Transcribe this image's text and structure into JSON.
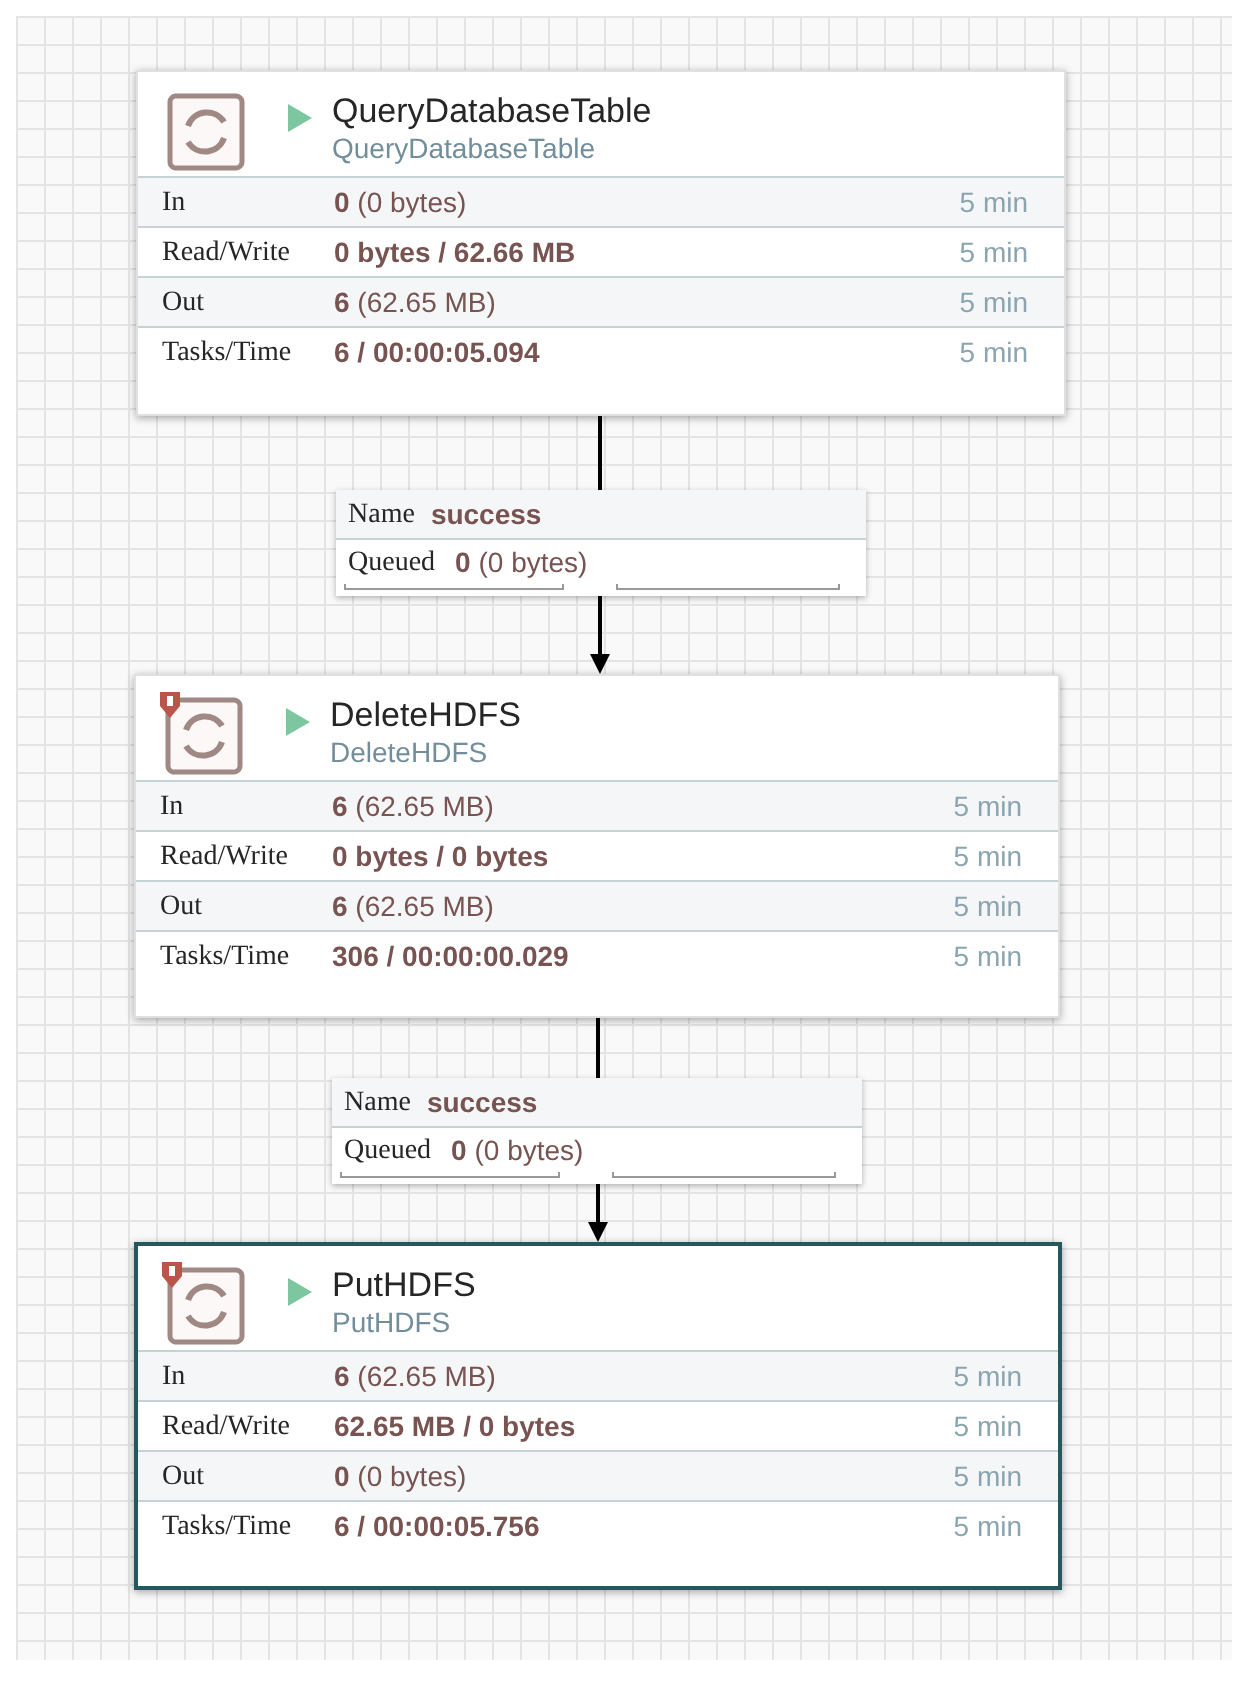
{
  "processors": [
    {
      "name": "QueryDatabaseTable",
      "type": "QueryDatabaseTable",
      "running": true,
      "restricted": false,
      "selected": false,
      "stats": [
        {
          "label": "In",
          "value": "**0** (0 bytes)",
          "time": "5 min"
        },
        {
          "label": "Read/Write",
          "value": "**0 bytes / 62.66 MB**",
          "time": "5 min"
        },
        {
          "label": "Out",
          "value": "**6** (62.65 MB)",
          "time": "5 min"
        },
        {
          "label": "Tasks/Time",
          "value": "**6 / 00:00:05.094**",
          "time": "5 min"
        }
      ]
    },
    {
      "name": "DeleteHDFS",
      "type": "DeleteHDFS",
      "running": true,
      "restricted": true,
      "selected": false,
      "stats": [
        {
          "label": "In",
          "value": "**6** (62.65 MB)",
          "time": "5 min"
        },
        {
          "label": "Read/Write",
          "value": "**0 bytes / 0 bytes**",
          "time": "5 min"
        },
        {
          "label": "Out",
          "value": "**6** (62.65 MB)",
          "time": "5 min"
        },
        {
          "label": "Tasks/Time",
          "value": "**306 / 00:00:00.029**",
          "time": "5 min"
        }
      ]
    },
    {
      "name": "PutHDFS",
      "type": "PutHDFS",
      "running": true,
      "restricted": true,
      "selected": true,
      "stats": [
        {
          "label": "In",
          "value": "**6** (62.65 MB)",
          "time": "5 min"
        },
        {
          "label": "Read/Write",
          "value": "**62.65 MB / 0 bytes**",
          "time": "5 min"
        },
        {
          "label": "Out",
          "value": "**0** (0 bytes)",
          "time": "5 min"
        },
        {
          "label": "Tasks/Time",
          "value": "**6 / 00:00:05.756**",
          "time": "5 min"
        }
      ]
    }
  ],
  "connections": [
    {
      "name_label": "Name",
      "name": "success",
      "queued_label": "Queued",
      "queued": "**0** (0 bytes)"
    },
    {
      "name_label": "Name",
      "name": "success",
      "queued_label": "Queued",
      "queued": "**0** (0 bytes)"
    }
  ]
}
